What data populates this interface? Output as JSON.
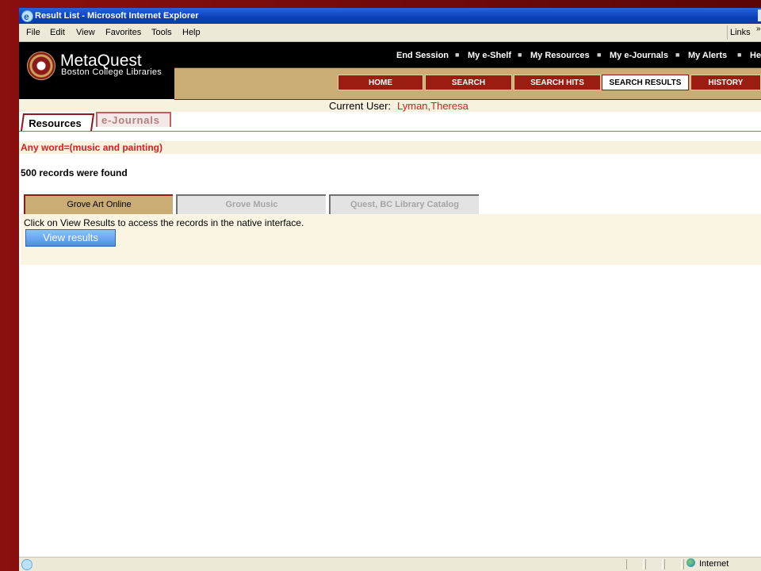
{
  "window": {
    "title": "Result List - Microsoft Internet Explorer"
  },
  "menu": {
    "items": [
      "File",
      "Edit",
      "View",
      "Favorites",
      "Tools",
      "Help"
    ],
    "links_label": "Links",
    "links_arrow": "»"
  },
  "header": {
    "logo_title": "MetaQuest",
    "logo_subtitle": "Boston College Libraries",
    "top_links": [
      "End Session",
      "My e-Shelf",
      "My Resources",
      "My e-Journals",
      "My Alerts",
      "He"
    ],
    "nav": [
      "HOME",
      "SEARCH",
      "SEARCH HITS",
      "SEARCH RESULTS",
      "HISTORY"
    ],
    "active_nav": "SEARCH RESULTS"
  },
  "current_user": {
    "label": "Current User:",
    "name": "Lyman,Theresa"
  },
  "resource_tabs": {
    "active": "Resources",
    "inactive": "e-Journals"
  },
  "query": "Any word=(music and painting)",
  "records_found": "500 records were found",
  "db_tabs": [
    "Grove Art Online",
    "Grove Music",
    "Quest, BC Library Catalog"
  ],
  "panel": {
    "hint": "Click on View Results to access the records in the native interface.",
    "button": "View results"
  },
  "status": {
    "zone": "Internet"
  },
  "colors": {
    "brand_maroon": "#8b1a1a",
    "gold": "#c9ad74",
    "link_red": "#d42020"
  }
}
